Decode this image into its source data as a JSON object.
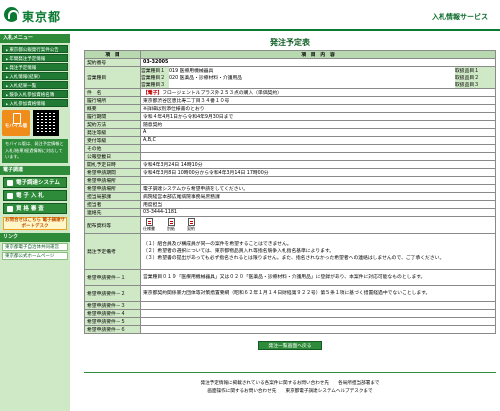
{
  "header": {
    "logo_text": "東京都",
    "service_title": "入札情報サービス"
  },
  "sidebar": {
    "menu_heading": "入札メニュー",
    "menu_items": [
      "東京都公報発行案件公告",
      "年間発注予定情報",
      "発注予定情報",
      "入札情報(結果)",
      "入札結果一覧",
      "競争入札参加資格名簿",
      "入札参加資格情報"
    ],
    "mobile_label": "モバイル版",
    "mobile_note": "モバイル版は、発注予定情報と入札(結果)経過情報に対応しています。",
    "links_heading": "電子調達",
    "big_buttons": [
      "電子調達システム(TOP)",
      "電 子 入 札",
      "資 格 審 査"
    ],
    "promo_text": "お問合せはこちら 電子調達サポートデスク",
    "links_heading2": "リンク",
    "links": [
      "東京都電子自治体共同運営",
      "東京都公式ホームページ"
    ]
  },
  "main": {
    "page_title": "発注予定表",
    "header_item": "項　目",
    "header_content": "項　目　内　容",
    "contract_no_label": "契約番号",
    "contract_no": "03-32005",
    "business_label": "営業種目",
    "business_rows": [
      {
        "no": "営業種目１",
        "name": "019 医療用機械器具",
        "right": "取扱品目１"
      },
      {
        "no": "営業種目２",
        "name": "020 医薬品・診療材料・介護用品",
        "right": "取扱品目２"
      },
      {
        "no": "営業種目３",
        "name": "",
        "right": "取扱品目３"
      }
    ],
    "rows": [
      {
        "label": "件　名",
        "tag": "【電子】",
        "value": "フロージェントルプラス外２５３点の購入（単価契約）"
      },
      {
        "label": "履行場所",
        "value": "東京都渋谷区恵比寿二丁目３４番１０号"
      },
      {
        "label": "概要",
        "value": "※詳細は別添仕様書のとおり"
      },
      {
        "label": "履行期間",
        "value": "令和４年4月1日から令和4年9月30日まで"
      },
      {
        "label": "契約方法",
        "value": "随意契約"
      },
      {
        "label": "発注等級",
        "value": "A"
      },
      {
        "label": "受付等級",
        "value": "A,B,C"
      },
      {
        "label": "その他",
        "value": ""
      },
      {
        "label": "公報登載日",
        "value": ""
      },
      {
        "label": "開札予定日時",
        "value": "令和4年3月24日 14時10分"
      },
      {
        "label": "希望申請期間",
        "value": "令和4年3月8日 10時00分から令和4年3月14日 17時00分"
      },
      {
        "label": "希望申請場所",
        "value": ""
      },
      {
        "label": "希望申請場所",
        "value": "電子調達システムから希望申請をしてください。"
      },
      {
        "label": "担当局部課",
        "value": "病院経営本部広尾病院事務局庶務課"
      },
      {
        "label": "担当者",
        "value": "用度担当"
      },
      {
        "label": "連絡先",
        "value": "03-3444-1181"
      }
    ],
    "attachment_label": "配布資料等",
    "attachments": [
      "仕様書",
      "別紙",
      "契約"
    ],
    "conditions_label": "発注予定備考",
    "conditions_lines": [
      "（１）組合員及び構成員が同一の案件を希望することはできません。",
      "（２）希望者の選択については、東京都物品買入れ等指名競争入札指名基準によります。",
      "（３）希望書の提出があっても必ず指名されるとは限りません。また、指名されなかった希望者への連絡はしませんので、ご了承ください。"
    ],
    "req_rows": [
      {
        "label": "希望申請要件－１",
        "value": "営業種目０１９「医療用機械器具」又は０２０「医薬品・診療材料・介護用品」に登録があり、本案件に対応可能なものとします。"
      },
      {
        "label": "希望申請要件－２",
        "value": "東京都契約関係暴力団体等対策措置要綱（昭和６２年１月１４日財経第９２２号）第５条１項に基づく措置経過中でないことします。"
      },
      {
        "label": "希望申請要件－３",
        "value": ""
      },
      {
        "label": "希望申請要件－４",
        "value": ""
      },
      {
        "label": "希望申請要件－５",
        "value": ""
      },
      {
        "label": "希望申請要件－６",
        "value": ""
      }
    ],
    "back_button": "発注一覧画面へ戻る"
  },
  "footer": {
    "line1": "発注予定情報に掲載されている各案件に関するお問い合わせ先　　各局所担当部署まで",
    "line2": "画面操作に関するお問い合わせ先　　東京都電子調達システムヘルプデスクまで"
  },
  "colors": {
    "brand_green": "#0a7a32",
    "menu_green": "#217a34",
    "label_bg": "#cfe8c5",
    "tag_red": "#c00000"
  }
}
